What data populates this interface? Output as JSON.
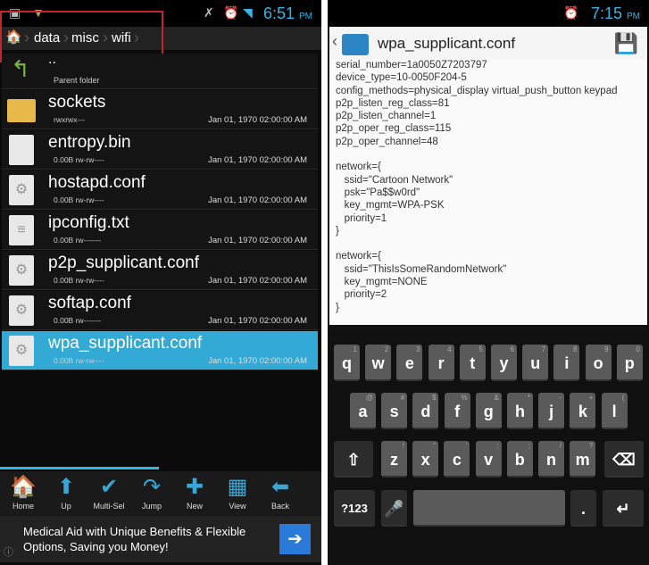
{
  "left": {
    "status": {
      "time": "6:51",
      "ampm": "PM"
    },
    "breadcrumb": [
      "data",
      "misc",
      "wifi"
    ],
    "parent": {
      "name": "..",
      "label": "Parent folder"
    },
    "files": [
      {
        "name": "sockets",
        "meta": "rwxrwx---",
        "date": "Jan 01, 1970 02:00:00 AM",
        "icon": "folder-icon"
      },
      {
        "name": "entropy.bin",
        "meta": "0.00B rw-rw----",
        "date": "Jan 01, 1970 02:00:00 AM",
        "icon": "file-icon"
      },
      {
        "name": "hostapd.conf",
        "meta": "0.00B rw-rw----",
        "date": "Jan 01, 1970 02:00:00 AM",
        "icon": "config-file-icon"
      },
      {
        "name": "ipconfig.txt",
        "meta": "0.00B rw-------",
        "date": "Jan 01, 1970 02:00:00 AM",
        "icon": "text-file-icon"
      },
      {
        "name": "p2p_supplicant.conf",
        "meta": "0.00B rw-rw----",
        "date": "Jan 01, 1970 02:00:00 AM",
        "icon": "config-file-icon"
      },
      {
        "name": "softap.conf",
        "meta": "0.00B rw-------",
        "date": "Jan 01, 1970 02:00:00 AM",
        "icon": "config-file-icon"
      },
      {
        "name": "wpa_supplicant.conf",
        "meta": "0.00B rw-rw----",
        "date": "Jan 01, 1970 02:00:00 AM",
        "icon": "config-file-icon",
        "selected": true
      }
    ],
    "toolbar": [
      "Home",
      "Up",
      "Multi-Sel",
      "Jump",
      "New",
      "View",
      "Back"
    ],
    "ad": {
      "line1": "Medical Aid with Unique Benefits & Flexible",
      "line2": "Options, Saving you Money!"
    },
    "colors": {
      "selected": "#33a9d6",
      "highlight_box": "#c0262c"
    }
  },
  "right": {
    "status": {
      "time": "7:15",
      "ampm": "PM"
    },
    "title": "wpa_supplicant.conf",
    "content": "serial_number=1a0050Z7203797\ndevice_type=10-0050F204-5\nconfig_methods=physical_display virtual_push_button keypad\np2p_listen_reg_class=81\np2p_listen_channel=1\np2p_oper_reg_class=115\np2p_oper_channel=48\n\nnetwork={\n   ssid=\"Cartoon Network\"\n   psk=\"Pa$$w0rd\"\n   key_mgmt=WPA-PSK\n   priority=1\n}\n\nnetwork={\n   ssid=\"ThisIsSomeRandomNetwork\"\n   key_mgmt=NONE\n   priority=2\n}",
    "keyboard": {
      "row1": [
        [
          "q",
          "1"
        ],
        [
          "w",
          "2"
        ],
        [
          "e",
          "3"
        ],
        [
          "r",
          "4"
        ],
        [
          "t",
          "5"
        ],
        [
          "y",
          "6"
        ],
        [
          "u",
          "7"
        ],
        [
          "i",
          "8"
        ],
        [
          "o",
          "9"
        ],
        [
          "p",
          "0"
        ]
      ],
      "row2": [
        [
          "a",
          "@"
        ],
        [
          "s",
          "#"
        ],
        [
          "d",
          "$"
        ],
        [
          "f",
          "%"
        ],
        [
          "g",
          "&"
        ],
        [
          "h",
          "*"
        ],
        [
          "j",
          "-"
        ],
        [
          "k",
          "+"
        ],
        [
          "l",
          "("
        ]
      ],
      "row3": [
        [
          "z",
          "!"
        ],
        [
          "x",
          "\""
        ],
        [
          "c",
          "'"
        ],
        [
          "v",
          ":"
        ],
        [
          "b",
          ";"
        ],
        [
          "n",
          "/"
        ],
        [
          "m",
          "?"
        ]
      ],
      "symbols": "?123",
      "period": "."
    }
  }
}
